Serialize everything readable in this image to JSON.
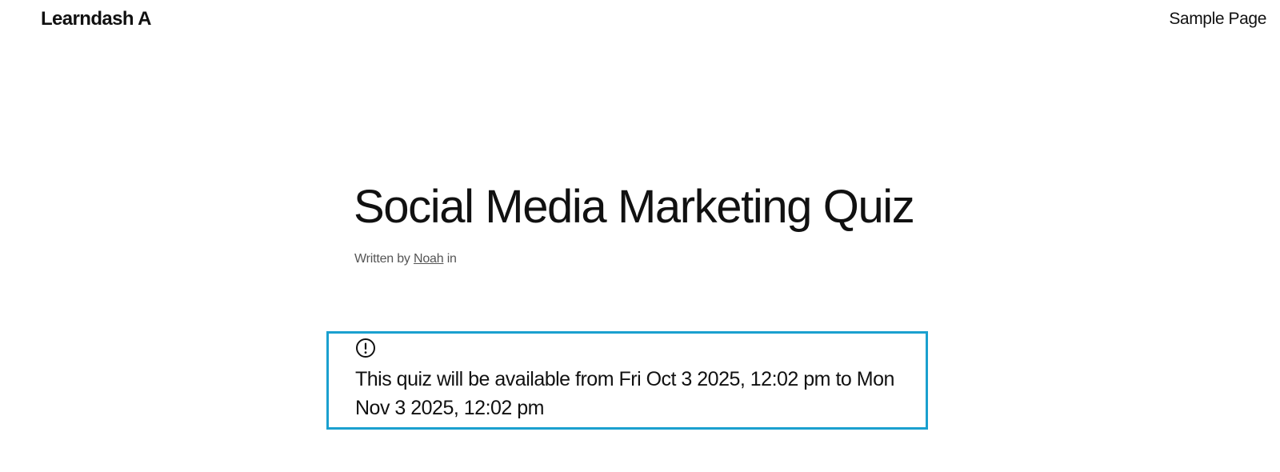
{
  "header": {
    "site_title": "Learndash A",
    "nav": {
      "sample_page": "Sample Page"
    }
  },
  "post": {
    "title": "Social Media Marketing Quiz",
    "byline": {
      "prefix": "Written by",
      "author": "Noah",
      "suffix": "in"
    }
  },
  "notice": {
    "icon": "exclamation-circle-icon",
    "text_before": "This quiz will be available from ",
    "start_date": "Fri Oct 3 2025, 12:02 pm",
    "text_between": " to ",
    "end_date": "Mon Nov 3 2025, 12:02 pm",
    "border_color": "#1aa0cf"
  }
}
